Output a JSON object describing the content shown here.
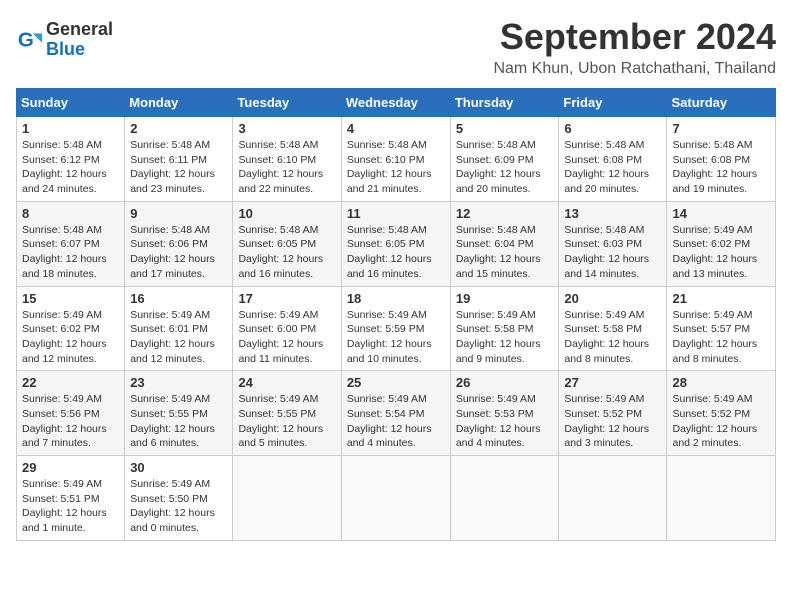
{
  "logo": {
    "line1": "General",
    "line2": "Blue"
  },
  "title": "September 2024",
  "location": "Nam Khun, Ubon Ratchathani, Thailand",
  "days_of_week": [
    "Sunday",
    "Monday",
    "Tuesday",
    "Wednesday",
    "Thursday",
    "Friday",
    "Saturday"
  ],
  "weeks": [
    [
      {
        "day": 1,
        "info": "Sunrise: 5:48 AM\nSunset: 6:12 PM\nDaylight: 12 hours\nand 24 minutes."
      },
      {
        "day": 2,
        "info": "Sunrise: 5:48 AM\nSunset: 6:11 PM\nDaylight: 12 hours\nand 23 minutes."
      },
      {
        "day": 3,
        "info": "Sunrise: 5:48 AM\nSunset: 6:10 PM\nDaylight: 12 hours\nand 22 minutes."
      },
      {
        "day": 4,
        "info": "Sunrise: 5:48 AM\nSunset: 6:10 PM\nDaylight: 12 hours\nand 21 minutes."
      },
      {
        "day": 5,
        "info": "Sunrise: 5:48 AM\nSunset: 6:09 PM\nDaylight: 12 hours\nand 20 minutes."
      },
      {
        "day": 6,
        "info": "Sunrise: 5:48 AM\nSunset: 6:08 PM\nDaylight: 12 hours\nand 20 minutes."
      },
      {
        "day": 7,
        "info": "Sunrise: 5:48 AM\nSunset: 6:08 PM\nDaylight: 12 hours\nand 19 minutes."
      }
    ],
    [
      {
        "day": 8,
        "info": "Sunrise: 5:48 AM\nSunset: 6:07 PM\nDaylight: 12 hours\nand 18 minutes."
      },
      {
        "day": 9,
        "info": "Sunrise: 5:48 AM\nSunset: 6:06 PM\nDaylight: 12 hours\nand 17 minutes."
      },
      {
        "day": 10,
        "info": "Sunrise: 5:48 AM\nSunset: 6:05 PM\nDaylight: 12 hours\nand 16 minutes."
      },
      {
        "day": 11,
        "info": "Sunrise: 5:48 AM\nSunset: 6:05 PM\nDaylight: 12 hours\nand 16 minutes."
      },
      {
        "day": 12,
        "info": "Sunrise: 5:48 AM\nSunset: 6:04 PM\nDaylight: 12 hours\nand 15 minutes."
      },
      {
        "day": 13,
        "info": "Sunrise: 5:48 AM\nSunset: 6:03 PM\nDaylight: 12 hours\nand 14 minutes."
      },
      {
        "day": 14,
        "info": "Sunrise: 5:49 AM\nSunset: 6:02 PM\nDaylight: 12 hours\nand 13 minutes."
      }
    ],
    [
      {
        "day": 15,
        "info": "Sunrise: 5:49 AM\nSunset: 6:02 PM\nDaylight: 12 hours\nand 12 minutes."
      },
      {
        "day": 16,
        "info": "Sunrise: 5:49 AM\nSunset: 6:01 PM\nDaylight: 12 hours\nand 12 minutes."
      },
      {
        "day": 17,
        "info": "Sunrise: 5:49 AM\nSunset: 6:00 PM\nDaylight: 12 hours\nand 11 minutes."
      },
      {
        "day": 18,
        "info": "Sunrise: 5:49 AM\nSunset: 5:59 PM\nDaylight: 12 hours\nand 10 minutes."
      },
      {
        "day": 19,
        "info": "Sunrise: 5:49 AM\nSunset: 5:58 PM\nDaylight: 12 hours\nand 9 minutes."
      },
      {
        "day": 20,
        "info": "Sunrise: 5:49 AM\nSunset: 5:58 PM\nDaylight: 12 hours\nand 8 minutes."
      },
      {
        "day": 21,
        "info": "Sunrise: 5:49 AM\nSunset: 5:57 PM\nDaylight: 12 hours\nand 8 minutes."
      }
    ],
    [
      {
        "day": 22,
        "info": "Sunrise: 5:49 AM\nSunset: 5:56 PM\nDaylight: 12 hours\nand 7 minutes."
      },
      {
        "day": 23,
        "info": "Sunrise: 5:49 AM\nSunset: 5:55 PM\nDaylight: 12 hours\nand 6 minutes."
      },
      {
        "day": 24,
        "info": "Sunrise: 5:49 AM\nSunset: 5:55 PM\nDaylight: 12 hours\nand 5 minutes."
      },
      {
        "day": 25,
        "info": "Sunrise: 5:49 AM\nSunset: 5:54 PM\nDaylight: 12 hours\nand 4 minutes."
      },
      {
        "day": 26,
        "info": "Sunrise: 5:49 AM\nSunset: 5:53 PM\nDaylight: 12 hours\nand 4 minutes."
      },
      {
        "day": 27,
        "info": "Sunrise: 5:49 AM\nSunset: 5:52 PM\nDaylight: 12 hours\nand 3 minutes."
      },
      {
        "day": 28,
        "info": "Sunrise: 5:49 AM\nSunset: 5:52 PM\nDaylight: 12 hours\nand 2 minutes."
      }
    ],
    [
      {
        "day": 29,
        "info": "Sunrise: 5:49 AM\nSunset: 5:51 PM\nDaylight: 12 hours\nand 1 minute."
      },
      {
        "day": 30,
        "info": "Sunrise: 5:49 AM\nSunset: 5:50 PM\nDaylight: 12 hours\nand 0 minutes."
      },
      null,
      null,
      null,
      null,
      null
    ]
  ]
}
